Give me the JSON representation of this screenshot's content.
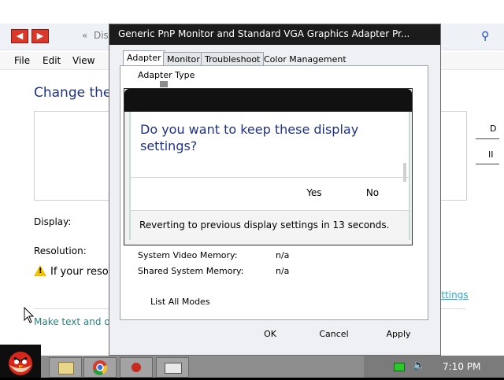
{
  "background_window": {
    "breadcrumb_prefix": "«",
    "breadcrumb": "Dis",
    "menu": [
      "File",
      "Edit",
      "View"
    ],
    "heading": "Change the",
    "right_snippets": [
      "D",
      "II"
    ],
    "display_label": "Display:",
    "resolution_label": "Resolution:",
    "warning_text": "If your resol",
    "link_bottom": "Make text and o",
    "link_right": "ettings"
  },
  "properties_dialog": {
    "title": "Generic PnP Monitor and Standard VGA Graphics Adapter Pr...",
    "tabs": [
      "Adapter",
      "Monitor",
      "Troubleshoot",
      "Color Management"
    ],
    "active_tab": "Adapter",
    "adapter_type_label": "Adapter Type",
    "info": [
      {
        "label": "System Video Memory:",
        "value": "n/a"
      },
      {
        "label": "Shared System Memory:",
        "value": "n/a"
      }
    ],
    "list_all_modes": "List All Modes",
    "buttons": {
      "ok": "OK",
      "cancel": "Cancel",
      "apply": "Apply"
    }
  },
  "confirm_dialog": {
    "question": "Do you want to keep these display settings?",
    "yes": "Yes",
    "no": "No",
    "revert_text": "Reverting to previous display settings in 13 seconds."
  },
  "taskbar": {
    "clock": "7:10 PM",
    "colors": {
      "bar": "#8d8d8d",
      "tray": "#7b7b7b"
    }
  },
  "icons": [
    "back-arrow-icon",
    "forward-arrow-icon",
    "search-icon",
    "warning-icon",
    "adapter-icon",
    "cursor-icon",
    "start-bird-icon",
    "network-icon",
    "volume-icon"
  ]
}
